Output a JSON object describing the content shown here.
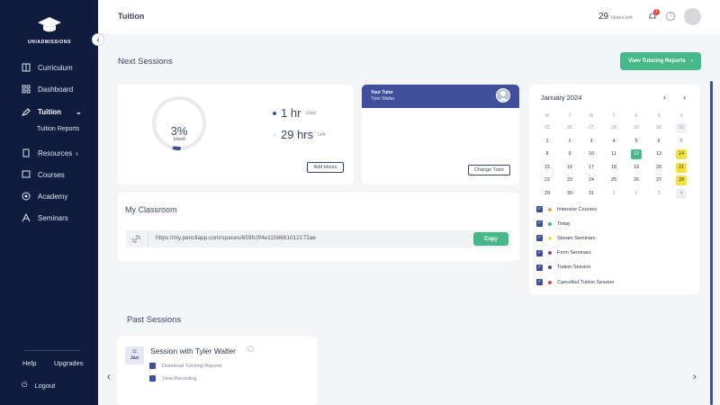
{
  "brand": {
    "logo_text": "UNIADMISSIONS"
  },
  "sidebar": {
    "items": [
      {
        "label": "Curriculum"
      },
      {
        "label": "Dashboard"
      },
      {
        "label": "Tuition"
      },
      {
        "label": "Resources"
      },
      {
        "label": "Courses"
      },
      {
        "label": "Academy"
      },
      {
        "label": "Seminars"
      }
    ],
    "sub_item": "Tuition Reports",
    "help": "Help",
    "upgrades": "Upgrades",
    "logout": "Logout"
  },
  "header": {
    "title": "Tuition",
    "hours_value": "29",
    "hours_label": "Hours left",
    "notification_count": "1"
  },
  "next_sessions": {
    "title": "Next Sessions",
    "report_button": "View Tutoring Reports",
    "usage": {
      "percent": "3%",
      "used_label": "Used",
      "percent_value": 3
    },
    "hours_used": "1 hr",
    "hours_used_label": "Used",
    "hours_left": "29 hrs",
    "hours_left_label": "Left",
    "add_hours": "Add Hours"
  },
  "tutor": {
    "label": "Your Tutor",
    "name": "Tyler Walter",
    "change_button": "Change Tutor"
  },
  "calendar": {
    "month": "January 2024",
    "weekdays": [
      "M",
      "T",
      "W",
      "T",
      "F",
      "S",
      "S"
    ],
    "weeks": [
      [
        "25",
        "26",
        "27",
        "28",
        "29",
        "30",
        "31"
      ],
      [
        "1",
        "2",
        "3",
        "4",
        "5",
        "6",
        "7"
      ],
      [
        "8",
        "9",
        "10",
        "11",
        "12",
        "13",
        "14"
      ],
      [
        "15",
        "16",
        "17",
        "18",
        "19",
        "20",
        "21"
      ],
      [
        "22",
        "23",
        "24",
        "25",
        "26",
        "27",
        "28"
      ],
      [
        "29",
        "30",
        "31",
        "1",
        "2",
        "3",
        "4"
      ]
    ],
    "legend": [
      {
        "label": "Intensive Courses",
        "color": "#f0a23b"
      },
      {
        "label": "Today",
        "color": "#46b889"
      },
      {
        "label": "Stream Seminars",
        "color": "#f5e13b"
      },
      {
        "label": "Form Seminars",
        "color": "#8e3fa8"
      },
      {
        "label": "Tuition Session",
        "color": "#3f4f9b"
      },
      {
        "label": "Cancelled Tuition Session",
        "color": "#e2463a"
      }
    ]
  },
  "classroom": {
    "title": "My Classroom",
    "url": "https://my.pencilapp.com/spaces/659fc0f4e1158661012172ae",
    "copy_button": "Copy"
  },
  "past_sessions": {
    "title": "Past Sessions",
    "items": [
      {
        "day": "11",
        "month": "Jan",
        "title": "Session with Tyler Walter",
        "download": "Download Tutoring Reports",
        "recording": "View Recording"
      }
    ]
  },
  "colors": {
    "navy": "#0f1c3f",
    "accent": "#3f4f9b",
    "green": "#46b889",
    "yellow": "#f5e13b"
  }
}
